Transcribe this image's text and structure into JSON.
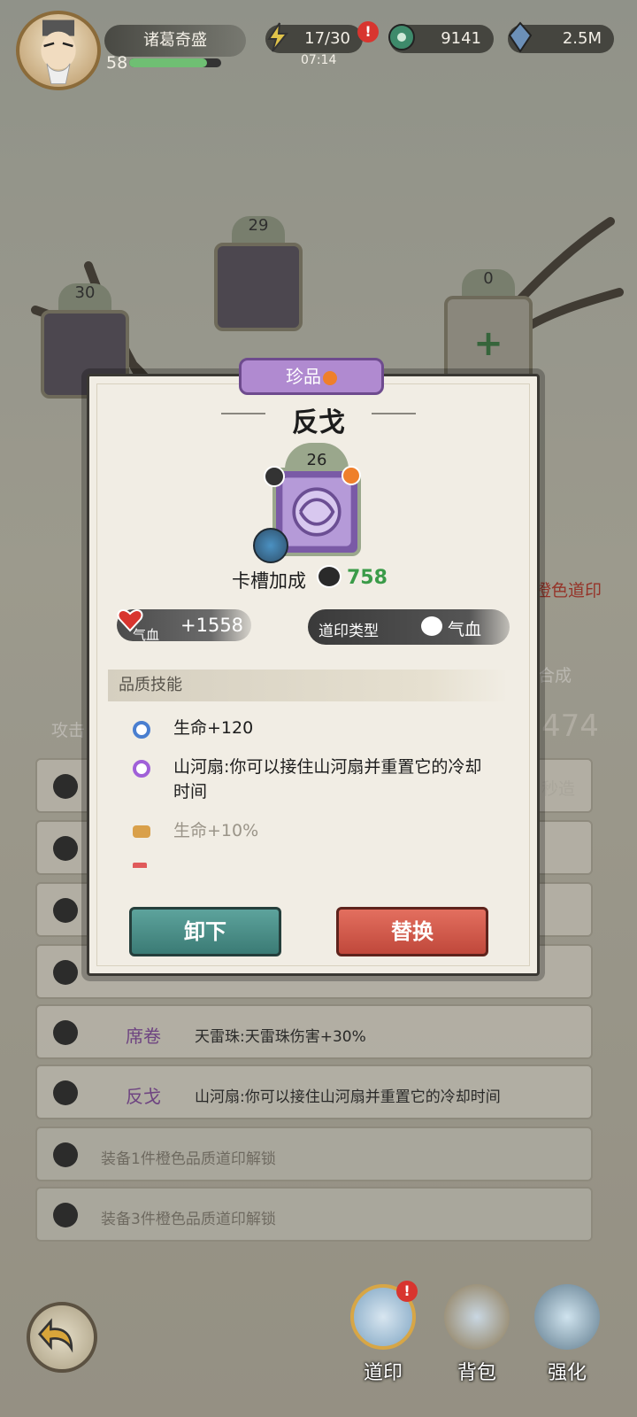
{
  "player": {
    "name": "诸葛奇盛",
    "level": "58",
    "xp_fraction": 0.85
  },
  "resources": {
    "stamina": "17/30",
    "stamina_timer": "07:14",
    "jade": "9141",
    "gems": "2.5M",
    "alert": "!"
  },
  "background": {
    "slots": [
      {
        "number": "30"
      },
      {
        "number": "29"
      },
      {
        "number": "0"
      }
    ],
    "attack_label": "攻击",
    "power_partial": "474",
    "side_text": "秒造",
    "orange_seal_text": "橙色道印",
    "merge_text": "合成",
    "rows": [
      {
        "name": "席卷",
        "desc": "天雷珠:天雷珠伤害+30%"
      },
      {
        "name": "反戈",
        "desc": "山河扇:你可以接住山河扇并重置它的冷却时间"
      }
    ],
    "locked_rows": [
      "装备1件橙色品质道印解锁",
      "装备3件橙色品质道印解锁"
    ]
  },
  "modal": {
    "rarity": "珍品",
    "title": "反戈",
    "item_level": "26",
    "slot_bonus_label": "卡槽加成",
    "slot_bonus_value": "758",
    "stat_label": "气血",
    "stat_value": "+1558",
    "type_label": "道印类型",
    "type_value": "气血",
    "skills_header": "品质技能",
    "skills": [
      "生命+120",
      "山河扇:你可以接住山河扇并重置它的冷却时间",
      "生命+10%"
    ],
    "remove_label": "卸下",
    "replace_label": "替换"
  },
  "nav": {
    "dao_label": "道印",
    "bag_label": "背包",
    "upgrade_label": "强化",
    "alert": "!"
  }
}
